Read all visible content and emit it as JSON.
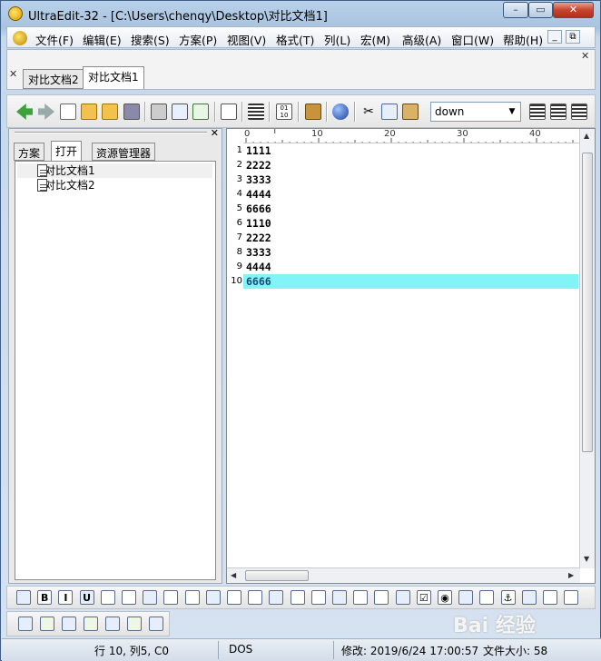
{
  "window": {
    "title": "UltraEdit-32 - [C:\\Users\\chenqy\\Desktop\\对比文档1]"
  },
  "menu": [
    "文件(F)",
    "编辑(E)",
    "搜索(S)",
    "方案(P)",
    "视图(V)",
    "格式(T)",
    "列(L)",
    "宏(M)",
    "高级(A)",
    "窗口(W)",
    "帮助(H)"
  ],
  "doc_tabs": [
    "对比文档2",
    "对比文档1"
  ],
  "toolbar": {
    "search_value": "down"
  },
  "left_pane": {
    "tabs": [
      "方案",
      "打开",
      "资源管理器"
    ],
    "files": [
      "对比文档1",
      "对比文档2"
    ]
  },
  "editor": {
    "ruler_marks": [
      "0",
      "10",
      "20",
      "30",
      "40"
    ],
    "line_numbers": [
      "1",
      "2",
      "3",
      "4",
      "5",
      "6",
      "7",
      "8",
      "9",
      "10"
    ],
    "lines": [
      "1111",
      "2222",
      "3333",
      "4444",
      "6666",
      "1110",
      "2222",
      "3333",
      "4444",
      "6666"
    ],
    "active_line": 10
  },
  "status": {
    "position": "行 10, 列5, C0",
    "format": "DOS",
    "modified": "修改: 2019/6/24 17:00:57",
    "size": "文件大小: 58"
  },
  "watermark": "Bai 经验",
  "colors": {
    "active_line": "#80f4f6",
    "title_bar": "#b9d1ea",
    "close_button": "#c6452e"
  }
}
